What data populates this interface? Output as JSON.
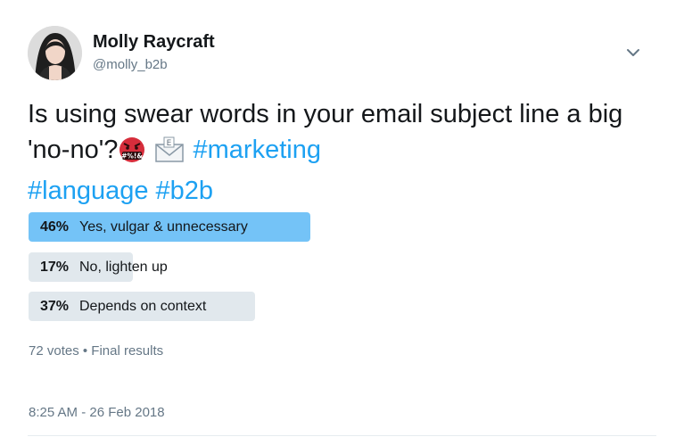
{
  "tweet": {
    "author_name": "Molly Raycraft",
    "author_handle": "@molly_b2b",
    "text_plain": "Is using swear words in your email subject line a big 'no-no'?",
    "hashtags": [
      "#marketing",
      "#language",
      "#b2b"
    ],
    "emojis": [
      "face-with-symbols-on-mouth-icon",
      "envelope-icon"
    ],
    "timestamp": "8:25 AM - 26 Feb 2018"
  },
  "poll": {
    "options": [
      {
        "percent_label": "46%",
        "percent": 46,
        "label": "Yes, vulgar & unnecessary",
        "winner": true
      },
      {
        "percent_label": "17%",
        "percent": 17,
        "label": "No, lighten up",
        "winner": false
      },
      {
        "percent_label": "37%",
        "percent": 37,
        "label": "Depends on context",
        "winner": false
      }
    ],
    "votes_summary": "72 votes • Final results"
  },
  "colors": {
    "winner_fill": "#74c3f7",
    "other_fill": "#e1e8ed",
    "hashtag": "#1da1f2",
    "muted": "#657786"
  },
  "icons": {
    "menu": "chevron-down-icon"
  }
}
